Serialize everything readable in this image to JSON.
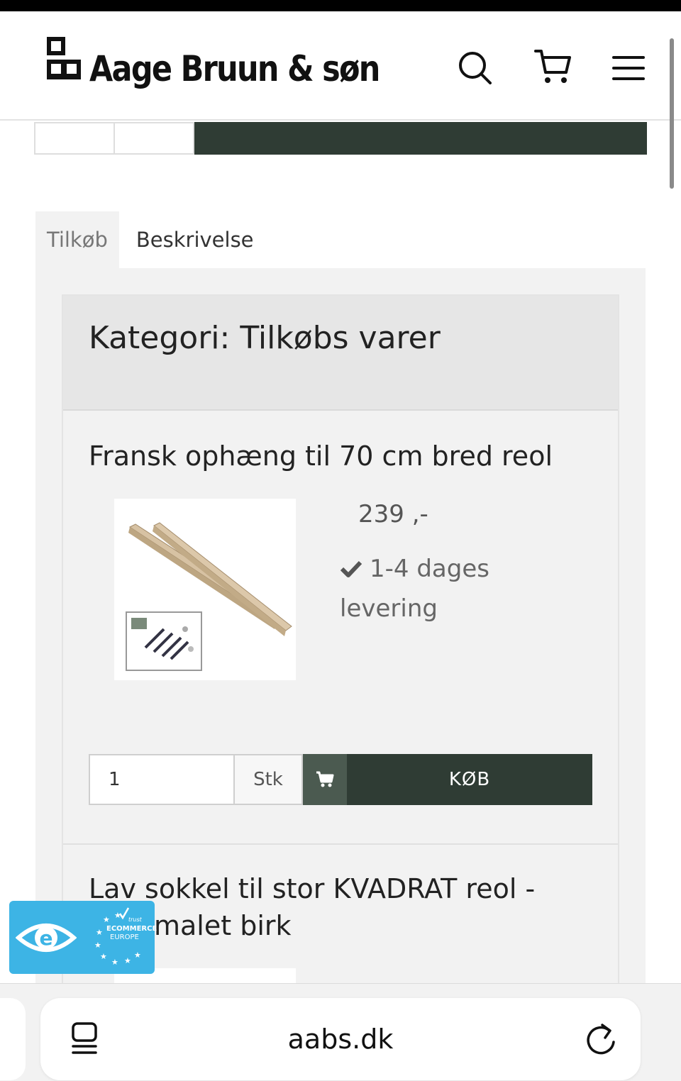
{
  "site": {
    "logo_text": "Aage Bruun & søn"
  },
  "header_icons": [
    "search-icon",
    "cart-icon",
    "menu-icon"
  ],
  "tabs": [
    {
      "label": "Tilkøb",
      "active": true
    },
    {
      "label": "Beskrivelse",
      "active": false
    }
  ],
  "category": {
    "heading": "Kategori: Tilkøbs varer"
  },
  "products": [
    {
      "title": "Fransk ophæng til 70 cm bred reol",
      "price": "239 ,-",
      "delivery": "1-4 dages levering",
      "quantity": "1",
      "unit": "Stk",
      "buy_label": "KØB"
    },
    {
      "title_line1": "Lav sokkel til stor KVADRAT reol -",
      "title_line2": "malet birk"
    }
  ],
  "trust_badge": {
    "icon": "e-trust-icon",
    "stars_icon": "eu-stars-icon",
    "line1": "trust",
    "line2": "ECOMMERCE",
    "line3": "EUROPE"
  },
  "browser": {
    "url": "aabs.dk",
    "left_icon": "tabs-icon",
    "right_icon": "reload-icon"
  },
  "colors": {
    "brand_dark_green": "#2f3c34",
    "cart_button_green": "#4b5a50",
    "panel_gray": "#f2f2f2",
    "trust_blue": "#3db4e5"
  }
}
